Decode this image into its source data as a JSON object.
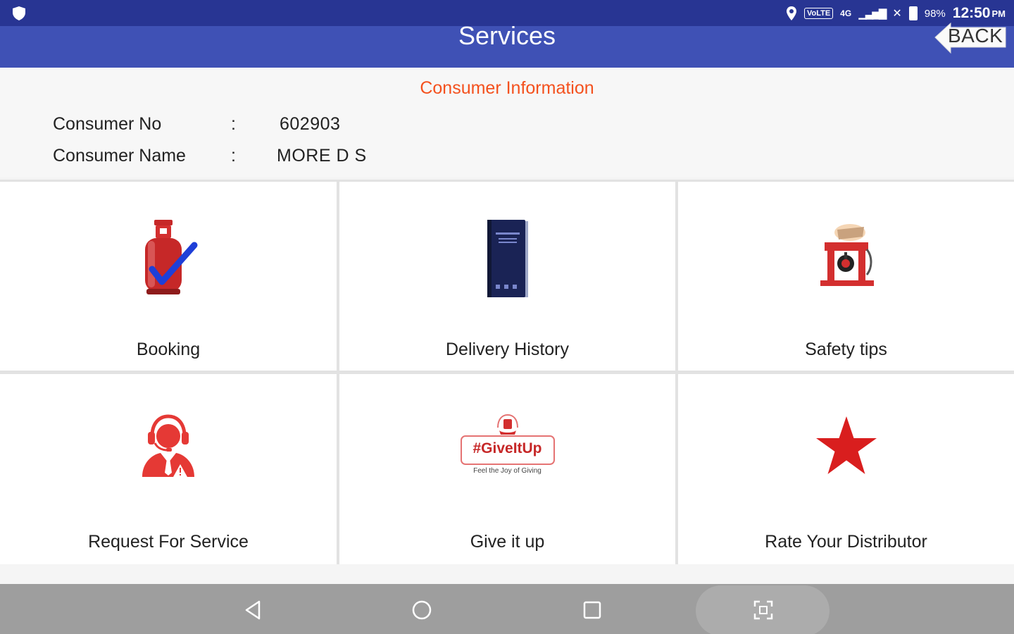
{
  "status_bar": {
    "battery_percent": "98%",
    "time": "12:50",
    "am_pm": "PM",
    "volte": "VoLTE",
    "network": "4G"
  },
  "app_bar": {
    "title": "Services",
    "back_label": "BACK"
  },
  "consumer_info": {
    "heading": "Consumer Information",
    "rows": [
      {
        "key": "Consumer No",
        "sep": ":",
        "value": "602903"
      },
      {
        "key": "Consumer Name",
        "sep": ":",
        "value": "MORE D S"
      }
    ]
  },
  "tiles": [
    {
      "label": "Booking",
      "icon": "gas-cylinder-check-icon"
    },
    {
      "label": "Delivery History",
      "icon": "book-icon"
    },
    {
      "label": "Safety tips",
      "icon": "safety-stove-icon"
    },
    {
      "label": "Request For Service",
      "icon": "support-agent-icon"
    },
    {
      "label": "Give it up",
      "icon": "giveitup-logo"
    },
    {
      "label": "Rate Your Distributor",
      "icon": "star-icon"
    }
  ],
  "giveitup_logo": {
    "tag": "#GiveItUp",
    "tagline": "Feel the Joy of Giving"
  },
  "colors": {
    "status_bar": "#283593",
    "app_bar": "#3f51b5",
    "accent": "#f4511e",
    "icon_red": "#e53935",
    "nav_bar": "#9e9e9e"
  }
}
